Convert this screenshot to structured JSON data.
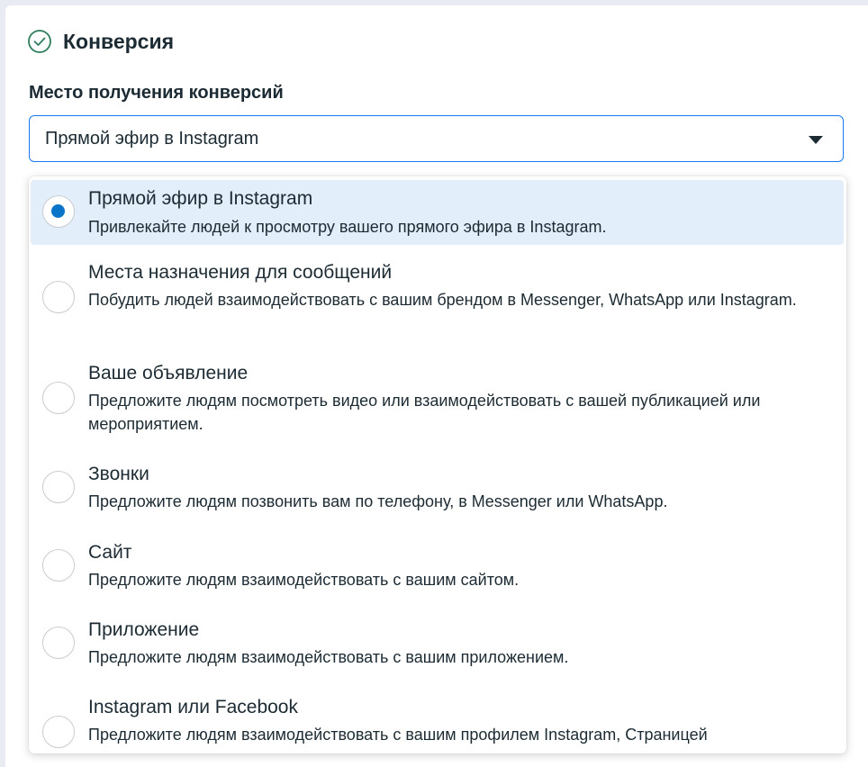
{
  "section": {
    "title": "Конверсия",
    "icon": "check-circle-icon",
    "icon_color": "#2e7d5b"
  },
  "field": {
    "label": "Место получения конверсий",
    "selected_value": "Прямой эфир в Instagram"
  },
  "accent_color": "#1877f2",
  "selected_radio_color": "#0a74c9",
  "options": [
    {
      "title": "Прямой эфир в Instagram",
      "description": "Привлекайте людей к просмотру вашего прямого эфира в Instagram.",
      "selected": true
    },
    {
      "title": "Места назначения для сообщений",
      "description": "Побудить людей взаимодействовать с вашим брендом в Messenger, WhatsApp или Instagram.",
      "selected": false
    },
    {
      "title": "Ваше объявление",
      "description": "Предложите людям посмотреть видео или взаимодействовать с вашей публикацией или мероприятием.",
      "selected": false
    },
    {
      "title": "Звонки",
      "description": "Предложите людям позвонить вам по телефону, в Messenger или WhatsApp.",
      "selected": false
    },
    {
      "title": "Сайт",
      "description": "Предложите людям взаимодействовать с вашим сайтом.",
      "selected": false
    },
    {
      "title": "Приложение",
      "description": "Предложите людям взаимодействовать с вашим приложением.",
      "selected": false
    },
    {
      "title": "Instagram или Facebook",
      "description": "Предложите людям взаимодействовать с вашим профилем Instagram, Страницей",
      "selected": false
    }
  ]
}
